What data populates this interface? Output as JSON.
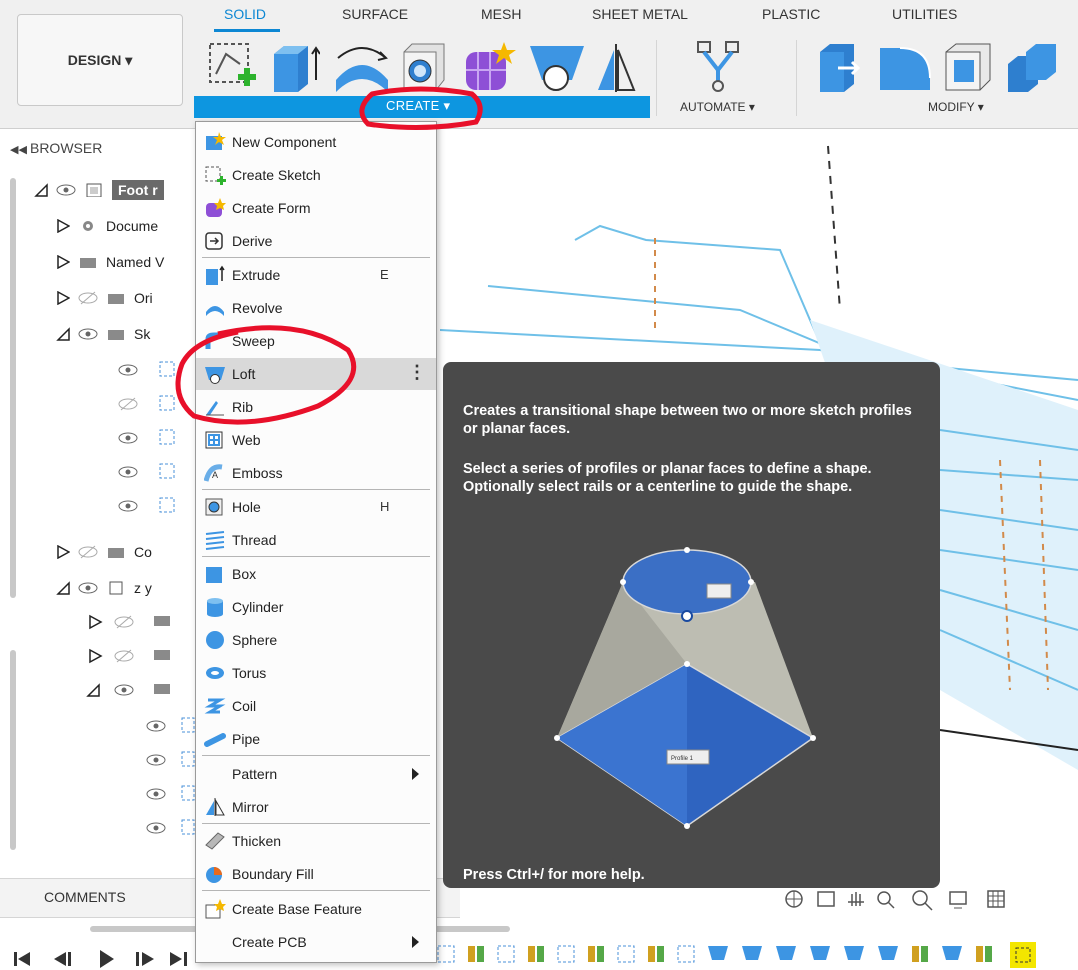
{
  "toolbar": {
    "design_label": "DESIGN ▾",
    "tabs": [
      {
        "label": "SOLID",
        "active": true
      },
      {
        "label": "SURFACE",
        "active": false
      },
      {
        "label": "MESH",
        "active": false
      },
      {
        "label": "SHEET METAL",
        "active": false
      },
      {
        "label": "PLASTIC",
        "active": false
      },
      {
        "label": "UTILITIES",
        "active": false
      }
    ],
    "create_label": "CREATE ▾",
    "automate_label": "AUTOMATE ▾",
    "modify_label": "MODIFY ▾"
  },
  "browser": {
    "header": "BROWSER",
    "rows": [
      {
        "label": "Foot r"
      },
      {
        "label": "Docume"
      },
      {
        "label": "Named V"
      },
      {
        "label": "Ori"
      },
      {
        "label": "Sk"
      },
      {
        "label": "Co"
      },
      {
        "label": "z y"
      }
    ]
  },
  "comments": {
    "label": "COMMENTS"
  },
  "menu": {
    "items": [
      {
        "label": "New Component",
        "shortcut": ""
      },
      {
        "label": "Create Sketch",
        "shortcut": ""
      },
      {
        "label": "Create Form",
        "shortcut": ""
      },
      {
        "label": "Derive",
        "shortcut": ""
      },
      {
        "label": "Extrude",
        "shortcut": "E"
      },
      {
        "label": "Revolve",
        "shortcut": ""
      },
      {
        "label": "Sweep",
        "shortcut": ""
      },
      {
        "label": "Loft",
        "shortcut": ""
      },
      {
        "label": "Rib",
        "shortcut": ""
      },
      {
        "label": "Web",
        "shortcut": ""
      },
      {
        "label": "Emboss",
        "shortcut": ""
      },
      {
        "label": "Hole",
        "shortcut": "H"
      },
      {
        "label": "Thread",
        "shortcut": ""
      },
      {
        "label": "Box",
        "shortcut": ""
      },
      {
        "label": "Cylinder",
        "shortcut": ""
      },
      {
        "label": "Sphere",
        "shortcut": ""
      },
      {
        "label": "Torus",
        "shortcut": ""
      },
      {
        "label": "Coil",
        "shortcut": ""
      },
      {
        "label": "Pipe",
        "shortcut": ""
      },
      {
        "label": "Pattern",
        "shortcut": ""
      },
      {
        "label": "Mirror",
        "shortcut": ""
      },
      {
        "label": "Thicken",
        "shortcut": ""
      },
      {
        "label": "Boundary Fill",
        "shortcut": ""
      },
      {
        "label": "Create Base Feature",
        "shortcut": ""
      },
      {
        "label": "Create PCB",
        "shortcut": ""
      }
    ],
    "more_glyph": "⋮"
  },
  "tooltip": {
    "line1": "Creates a transitional shape between two or more sketch profiles or planar faces.",
    "line2": "Select a series of profiles or planar faces to define a shape. Optionally select rails or a centerline to guide the shape.",
    "profile_label": "Profile 1",
    "footer": "Press Ctrl+/ for more help."
  },
  "colors": {
    "accent": "#0d96e0",
    "annotation": "#e8102a",
    "tooltip_bg": "#4a4a4a",
    "highlight": "#d9d9d9"
  }
}
